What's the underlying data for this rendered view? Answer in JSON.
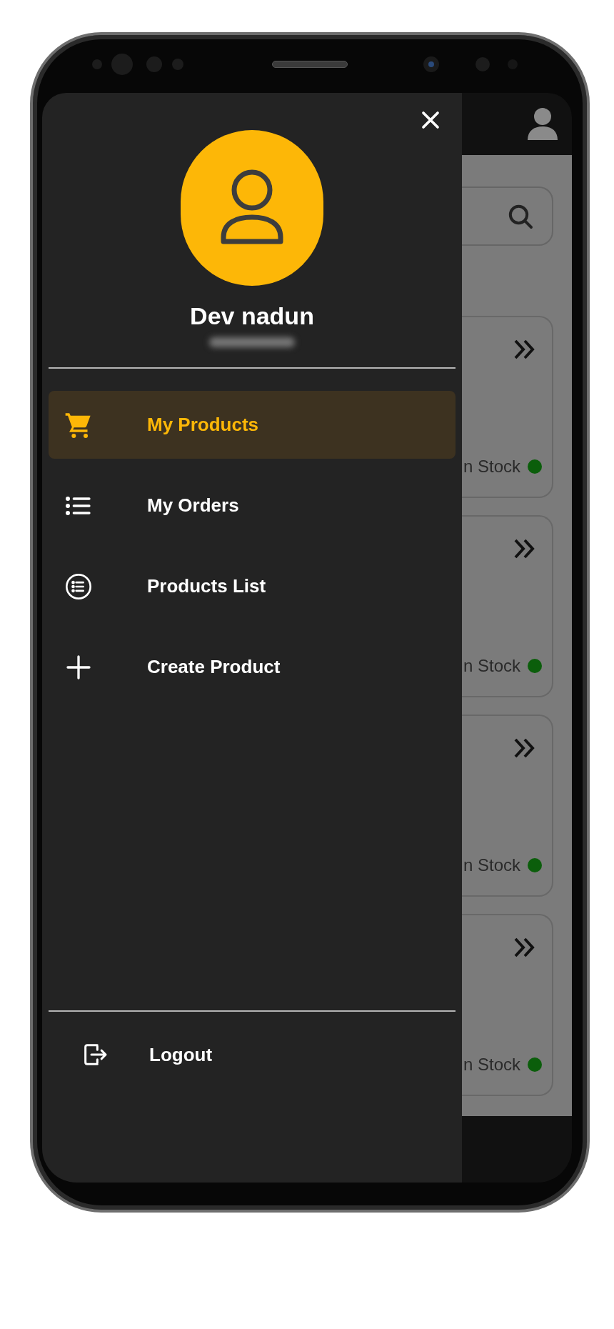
{
  "drawer": {
    "user": {
      "name": "Dev nadun"
    },
    "menu": [
      {
        "label": "My Products",
        "selected": true
      },
      {
        "label": "My Orders",
        "selected": false
      },
      {
        "label": "Products List",
        "selected": false
      },
      {
        "label": "Create Product",
        "selected": false
      }
    ],
    "logout": {
      "label": "Logout"
    }
  },
  "background": {
    "cards": [
      {
        "status": "n Stock"
      },
      {
        "status": "n Stock"
      },
      {
        "status": "n Stock"
      },
      {
        "status": "n Stock"
      }
    ]
  }
}
